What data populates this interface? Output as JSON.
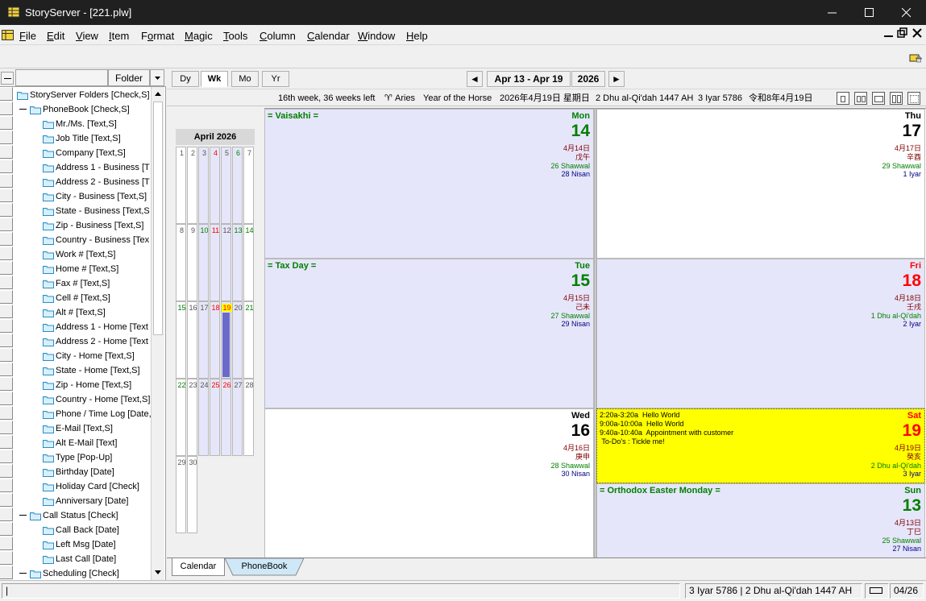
{
  "window": {
    "title": "StoryServer - [221.plw]"
  },
  "menu": [
    "File",
    "Edit",
    "View",
    "Item",
    "Format",
    "Magic",
    "Tools",
    "Column",
    "Calendar",
    "Window",
    "Help"
  ],
  "menu_accel": [
    "F",
    "E",
    "V",
    "I",
    "o",
    "M",
    "T",
    "C",
    "C",
    "W",
    "H"
  ],
  "left_panel": {
    "folder_header": "Folder",
    "tree": [
      {
        "label": "StoryServer Folders [Check,S]",
        "level": 0,
        "expand": false
      },
      {
        "label": "PhoneBook [Check,S]",
        "level": 0,
        "expand": true
      },
      {
        "label": "Mr./Ms. [Text,S]",
        "level": 1
      },
      {
        "label": "Job Title [Text,S]",
        "level": 1
      },
      {
        "label": "Company [Text,S]",
        "level": 1
      },
      {
        "label": "Address 1 - Business [T",
        "level": 1
      },
      {
        "label": "Address 2 - Business [T",
        "level": 1
      },
      {
        "label": "City - Business [Text,S]",
        "level": 1
      },
      {
        "label": "State - Business [Text,S",
        "level": 1
      },
      {
        "label": "Zip - Business [Text,S]",
        "level": 1
      },
      {
        "label": "Country - Business [Tex",
        "level": 1
      },
      {
        "label": "Work # [Text,S]",
        "level": 1
      },
      {
        "label": "Home # [Text,S]",
        "level": 1
      },
      {
        "label": "Fax # [Text,S]",
        "level": 1
      },
      {
        "label": "Cell # [Text,S]",
        "level": 1
      },
      {
        "label": "Alt # [Text,S]",
        "level": 1
      },
      {
        "label": "Address 1 - Home [Text",
        "level": 1
      },
      {
        "label": "Address 2 - Home [Text",
        "level": 1
      },
      {
        "label": "City - Home [Text,S]",
        "level": 1
      },
      {
        "label": "State - Home [Text,S]",
        "level": 1
      },
      {
        "label": "Zip - Home [Text,S]",
        "level": 1
      },
      {
        "label": "Country - Home [Text,S]",
        "level": 1
      },
      {
        "label": "Phone / Time Log [Date,S",
        "level": 1
      },
      {
        "label": "E-Mail [Text,S]",
        "level": 1
      },
      {
        "label": "Alt E-Mail [Text]",
        "level": 1
      },
      {
        "label": "Type [Pop-Up]",
        "level": 1
      },
      {
        "label": "Birthday [Date]",
        "level": 1
      },
      {
        "label": "Holiday Card [Check]",
        "level": 1
      },
      {
        "label": "Anniversary [Date]",
        "level": 1
      },
      {
        "label": "Call Status [Check]",
        "level": 0,
        "expand": true
      },
      {
        "label": "Call Back [Date]",
        "level": 1
      },
      {
        "label": "Left Msg [Date]",
        "level": 1
      },
      {
        "label": "Last Call [Date]",
        "level": 1
      },
      {
        "label": "Scheduling [Check]",
        "level": 0,
        "expand": true
      }
    ]
  },
  "calendar": {
    "view_tabs": [
      "Dy",
      "Wk",
      "Mo",
      "Yr"
    ],
    "active_view": "Wk",
    "range": "Apr 13 - Apr 19",
    "year": "2026",
    "prev_arrow": "◄",
    "next_arrow": "►",
    "info": {
      "week": "16th week, 36 weeks left",
      "zodiac_symbol": "♈",
      "zodiac": "Aries",
      "chinese_year": "Year of the Horse",
      "japanese_date": "2026年4月19日 星期日",
      "islamic": "2 Dhu al-Qi'dah 1447 AH",
      "hebrew": "3 Iyar 5786",
      "reiwa": "令和8年4月19日"
    },
    "mini_month": {
      "title": "April 2026",
      "days": [
        1,
        2,
        3,
        4,
        5,
        6,
        7,
        8,
        9,
        10,
        11,
        12,
        13,
        14,
        15,
        16,
        17,
        18,
        19,
        20,
        21,
        22,
        23,
        24,
        25,
        26,
        27,
        28,
        29,
        30
      ],
      "highlight": 19
    },
    "days": [
      {
        "id": "mon",
        "name": "Mon",
        "num": "14",
        "holiday": "= Vaisakhi =",
        "cjk1": "4月14日",
        "cjk2": "戊午",
        "islamic": "26 Shawwal",
        "hebrew": "28 Nisan",
        "color": "#008000",
        "bg": "#e6e6fa",
        "events": []
      },
      {
        "id": "tue",
        "name": "Tue",
        "num": "15",
        "holiday": "= Tax Day =",
        "cjk1": "4月15日",
        "cjk2": "己未",
        "islamic": "27 Shawwal",
        "hebrew": "29 Nisan",
        "color": "#008000",
        "bg": "#e6e6fa",
        "events": []
      },
      {
        "id": "wed",
        "name": "Wed",
        "num": "16",
        "holiday": "",
        "cjk1": "4月16日",
        "cjk2": "庚申",
        "islamic": "28 Shawwal",
        "hebrew": "30 Nisan",
        "color": "#000000",
        "bg": "#ffffff",
        "events": []
      },
      {
        "id": "thu",
        "name": "Thu",
        "num": "17",
        "holiday": "",
        "cjk1": "4月17日",
        "cjk2": "辛酉",
        "islamic": "29 Shawwal",
        "hebrew": "1 Iyar",
        "color": "#000000",
        "bg": "#ffffff",
        "events": []
      },
      {
        "id": "fri",
        "name": "Fri",
        "num": "18",
        "holiday": "",
        "cjk1": "4月18日",
        "cjk2": "壬戌",
        "islamic": "1 Dhu al-Qi'dah",
        "hebrew": "2 Iyar",
        "color": "#ff0000",
        "bg": "#e6e6fa",
        "events": []
      },
      {
        "id": "sat",
        "name": "Sat",
        "num": "19",
        "holiday": "",
        "cjk1": "4月19日",
        "cjk2": "癸亥",
        "islamic": "2 Dhu al-Qi'dah",
        "hebrew": "3 Iyar",
        "color": "#ff0000",
        "bg": "#ffff00",
        "events": [
          "2:20a-3:20a  Hello World",
          "9:00a-10:00a  Hello World",
          "9:40a-10:40a  Appointment with customer",
          " To-Do's : Tickle me!"
        ]
      },
      {
        "id": "sun",
        "name": "Sun",
        "num": "13",
        "holiday": "= Orthodox Easter Monday =",
        "cjk1": "4月13日",
        "cjk2": "丁巳",
        "islamic": "25 Shawwal",
        "hebrew": "27 Nisan",
        "color": "#008000",
        "bg": "#e6e6fa",
        "events": []
      }
    ]
  },
  "bottom_tabs": [
    "Calendar",
    "PhoneBook"
  ],
  "status": {
    "left": "|",
    "dates": "3 Iyar 5786  |  2 Dhu al-Qi'dah 1447 AH",
    "page": "04/26"
  },
  "colors": {
    "titlebar": "#202020",
    "lavender": "#e6e6fa",
    "today_yellow": "#ffff00",
    "mini_highlight": "#6a6ac8"
  }
}
